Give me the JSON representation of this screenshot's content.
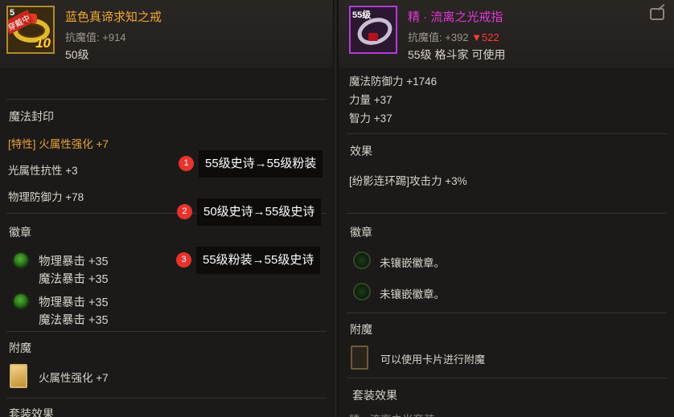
{
  "left": {
    "item": {
      "icon_number": "5",
      "icon_tag": "穿戴中",
      "icon_level": "10",
      "name": "蓝色真谛求知之戒",
      "resist_label": "抗魔值:",
      "resist_value": "+914",
      "level": "50级"
    },
    "magic_seal": {
      "title": "魔法封印",
      "rows": [
        "[特性] 火属性强化 +7",
        "光属性抗性 +3",
        "物理防御力 +78"
      ]
    },
    "emblem": {
      "title": "徽章",
      "slots": [
        {
          "line1": "物理暴击 +35",
          "line2": "魔法暴击 +35"
        },
        {
          "line1": "物理暴击 +35",
          "line2": "魔法暴击 +35"
        }
      ]
    },
    "enchant": {
      "title": "附魔",
      "text": "火属性强化 +7"
    },
    "set_effect": {
      "title": "套装效果"
    }
  },
  "right": {
    "item": {
      "icon_number": "55级",
      "name": "精 · 流离之光戒指",
      "resist_label": "抗魔值:",
      "resist_value": "+392",
      "resist_delta": "▼522",
      "level_info": "55级 格斗家 可使用"
    },
    "stats": [
      "魔法防御力 +1746",
      "力量 +37",
      "智力 +37"
    ],
    "effect": {
      "title": "效果",
      "text": "[纷影连环踢]攻击力 +3%"
    },
    "emblem": {
      "title": "徽章",
      "slots": [
        "未镶嵌徽章。",
        "未镶嵌徽章。"
      ]
    },
    "enchant": {
      "title": "附魔",
      "text": "可以使用卡片进行附魔"
    },
    "set_effect": {
      "title": "套装效果",
      "partial": "精 · 流离之光套装"
    }
  },
  "annotations": [
    {
      "badge": "1",
      "text": "55级史诗→55级粉装"
    },
    {
      "badge": "2",
      "text": "50级史诗→55级史诗"
    },
    {
      "badge": "3",
      "text": "55级粉装→55级史诗"
    }
  ],
  "colors": {
    "epic_name": "#f0a830",
    "legend_name": "#e03ad8",
    "attribute_orange": "#e8a13a",
    "delta_red": "#ff3b3b",
    "badge_red": "#e8322d"
  }
}
